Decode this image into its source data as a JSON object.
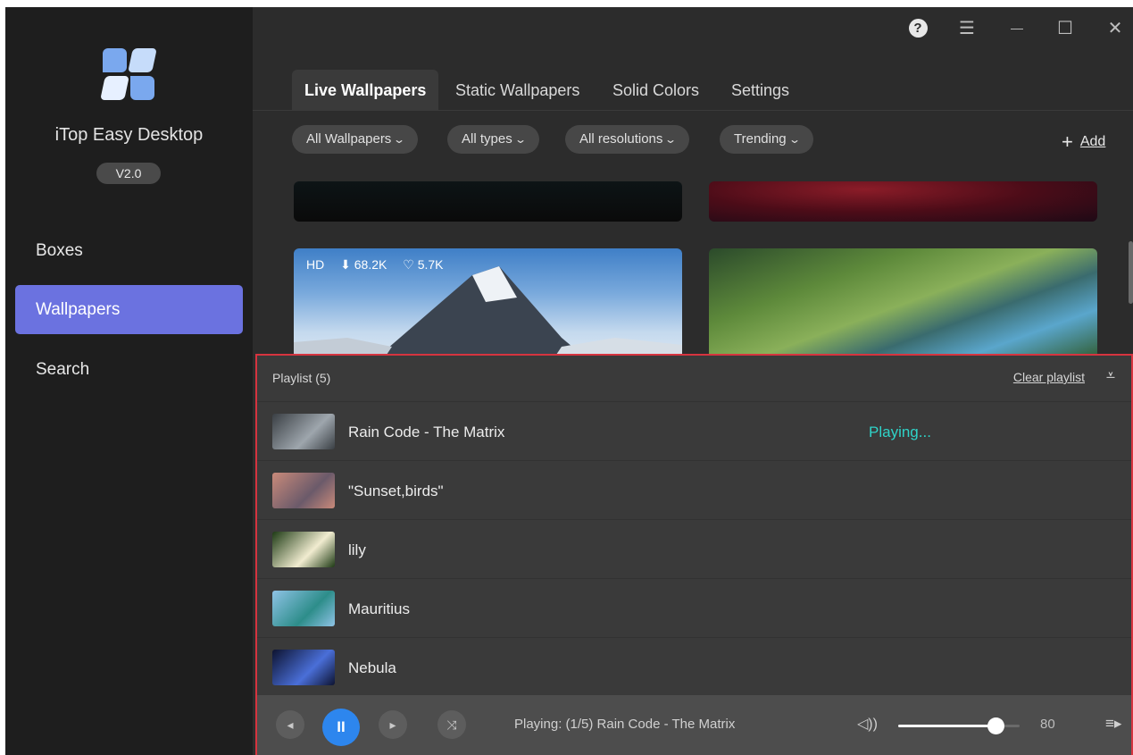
{
  "window": {
    "controls": {
      "help": "?",
      "menu": "☰",
      "minimize": "—",
      "maximize": "☐",
      "close": "✕"
    }
  },
  "sidebar": {
    "app_name": "iTop Easy Desktop",
    "version": "V2.0",
    "items": [
      {
        "label": "Boxes",
        "active": false
      },
      {
        "label": "Wallpapers",
        "active": true
      },
      {
        "label": "Search",
        "active": false
      }
    ]
  },
  "tabs": [
    {
      "label": "Live Wallpapers",
      "active": true
    },
    {
      "label": "Static Wallpapers",
      "active": false
    },
    {
      "label": "Solid Colors",
      "active": false
    },
    {
      "label": "Settings",
      "active": false
    }
  ],
  "filters": {
    "wallpapers": "All Wallpapers",
    "types": "All types",
    "resolutions": "All resolutions",
    "sort": "Trending",
    "add_label": "Add"
  },
  "featured_card": {
    "quality": "HD",
    "downloads": "68.2K",
    "likes": "5.7K"
  },
  "playlist": {
    "title": "Playlist (5)",
    "clear_label": "Clear playlist",
    "items": [
      {
        "title": "Rain Code - The Matrix",
        "status": "Playing...",
        "thumb_colors": [
          "#3a3f44",
          "#9ea6ad"
        ]
      },
      {
        "title": "\"Sunset,birds\"",
        "status": "",
        "thumb_colors": [
          "#c98a7a",
          "#6b5a6a"
        ]
      },
      {
        "title": "lily",
        "status": "",
        "thumb_colors": [
          "#1d3a14",
          "#f1ecd0"
        ]
      },
      {
        "title": "Mauritius",
        "status": "",
        "thumb_colors": [
          "#8fc3e6",
          "#2d8d8a"
        ]
      },
      {
        "title": "Nebula",
        "status": "",
        "thumb_colors": [
          "#0d1330",
          "#4a6fd8"
        ]
      }
    ]
  },
  "player": {
    "now_playing": "Playing: (1/5) Rain Code - The Matrix",
    "volume": 80,
    "volume_label": "80",
    "icons": {
      "prev": "◂",
      "pause": "II",
      "next": "▸",
      "shuffle": "⤨",
      "volume": "🔈︎",
      "queue": "≡"
    }
  },
  "colors": {
    "accent": "#6b72e0",
    "play_button": "#2d86ee",
    "playing_status": "#2fd3c8",
    "highlight_border": "#d6343f"
  }
}
